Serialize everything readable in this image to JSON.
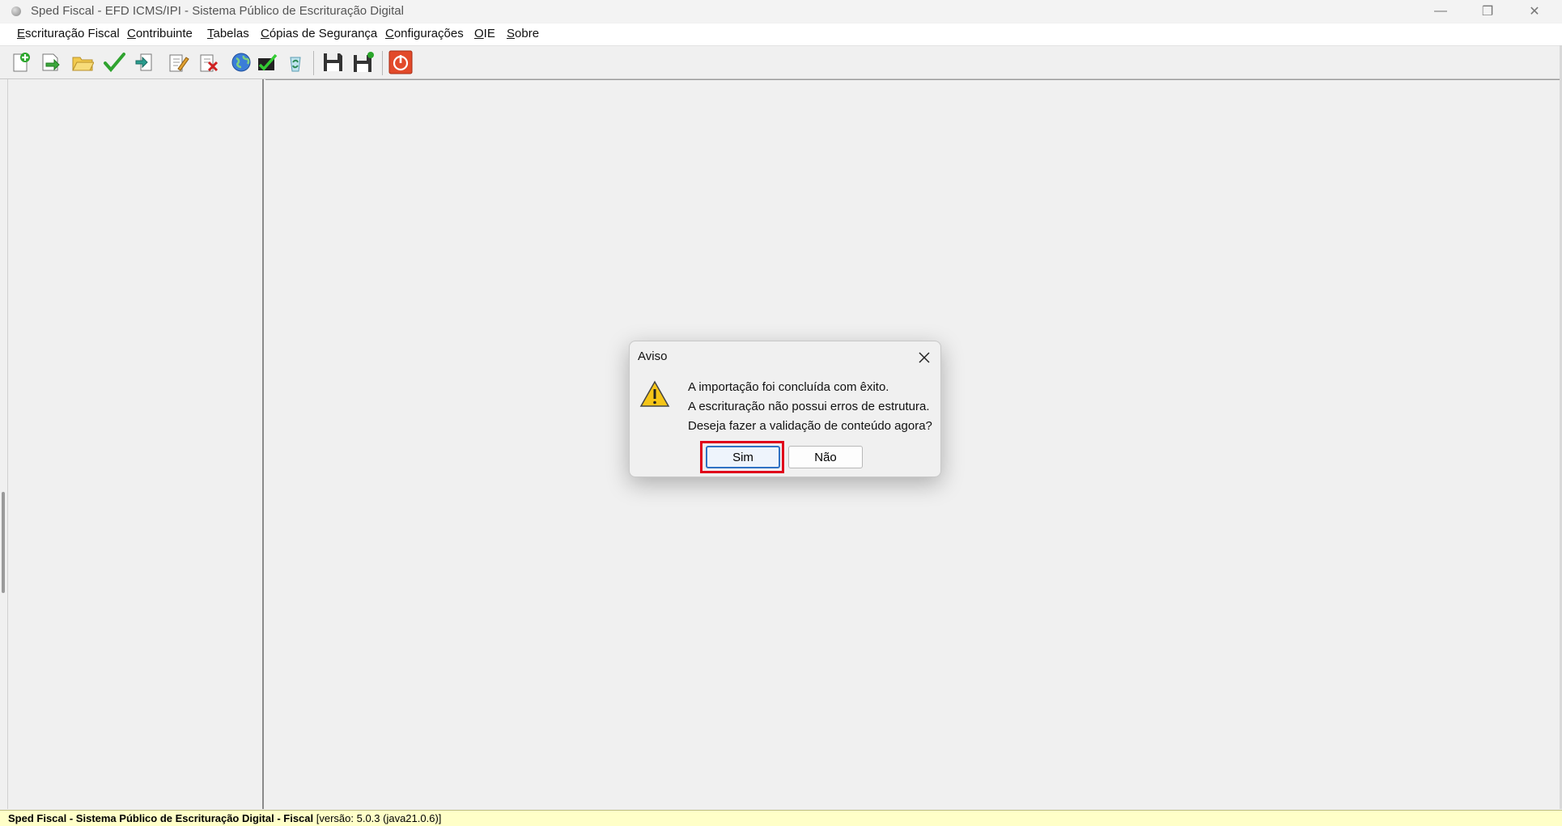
{
  "window": {
    "title": "Sped Fiscal - EFD ICMS/IPI - Sistema Público de Escrituração Digital",
    "minimize_glyph": "—",
    "restore_glyph": "❐",
    "close_glyph": "✕"
  },
  "menu": {
    "items": [
      "Escrituração Fiscal",
      "Contribuinte",
      "Tabelas",
      "Cópias de Segurança",
      "Configurações",
      "OIE",
      "Sobre"
    ]
  },
  "toolbar": {
    "icons": [
      "new-document-icon",
      "import-arrow-icon",
      "open-folder-icon",
      "validate-check-icon",
      "export-icon",
      "sign-document-icon",
      "delete-document-icon",
      "globe-icon",
      "transmit-icon",
      "recycle-icon",
      "save-icon",
      "save-as-icon",
      "exit-power-icon"
    ]
  },
  "dialog": {
    "title": "Aviso",
    "lines": [
      "A importação foi concluída com êxito.",
      "A escrituração não possui erros de estrutura.",
      "Deseja fazer a validação de conteúdo agora?"
    ],
    "yes_label": "Sim",
    "no_label": "Não",
    "highlight_color": "#e0001a"
  },
  "statusbar": {
    "bold_text": "Sped Fiscal - Sistema Público de Escrituração Digital - Fiscal",
    "version_text": "[versão: 5.0.3 (java21.0.6)]",
    "background": "#ffffc8"
  }
}
